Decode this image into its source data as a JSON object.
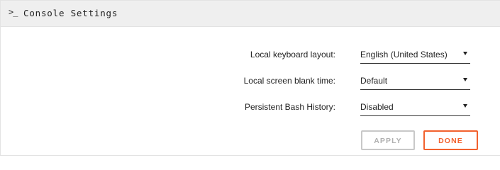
{
  "header": {
    "icon": "terminal-icon",
    "icon_glyph": ">_",
    "title": "Console Settings"
  },
  "settings": [
    {
      "label": "Local keyboard layout:",
      "value": "English (United States)"
    },
    {
      "label": "Local screen blank time:",
      "value": "Default"
    },
    {
      "label": "Persistent Bash History:",
      "value": "Disabled"
    }
  ],
  "buttons": {
    "apply_label": "APPLY",
    "apply_state": "disabled",
    "done_label": "DONE"
  },
  "colors": {
    "accent": "#f2612e",
    "header_bg": "#efefef",
    "disabled": "#c8c8c8"
  }
}
